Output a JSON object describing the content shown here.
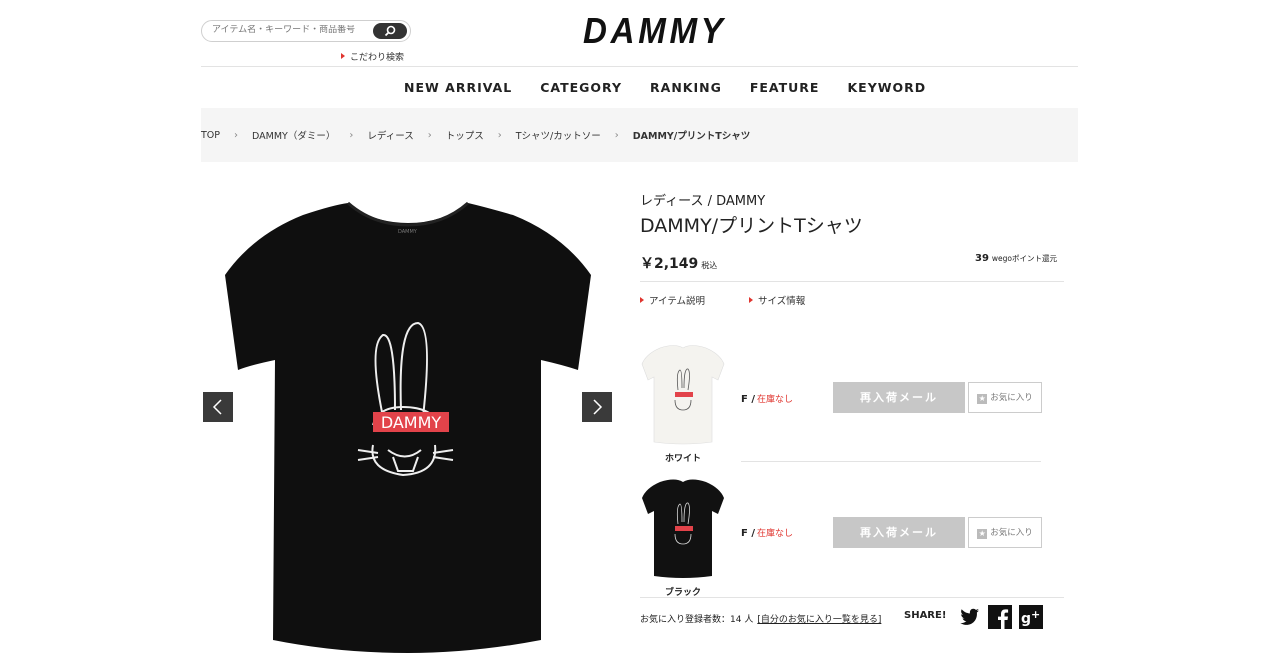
{
  "header": {
    "logo": "DAMMY",
    "search_placeholder": "アイテム名・キーワード・商品番号",
    "advanced_search": "こだわり検索"
  },
  "nav": [
    "NEW ARRIVAL",
    "CATEGORY",
    "RANKING",
    "FEATURE",
    "KEYWORD"
  ],
  "breadcrumb": [
    "TOP",
    "DAMMY（ダミー）",
    "レディース",
    "トップス",
    "Tシャツ/カットソー",
    "DAMMY/プリントTシャツ"
  ],
  "product": {
    "category": "レディース / DAMMY",
    "name": "DAMMY/プリントTシャツ",
    "price": "￥2,149",
    "tax_label": "税込",
    "points_value": "39",
    "points_label": "wegoポイント還元",
    "item_description_link": "アイテム説明",
    "size_info_link": "サイズ情報",
    "print_text": "DAMMY",
    "tag_text": "DAMMY"
  },
  "variants": [
    {
      "color": "ホワイト",
      "size": "F",
      "stock": "在庫なし",
      "restock_button": "再入荷メール",
      "fav_button": "お気に入り",
      "shirt_color": "#f4f3ef"
    },
    {
      "color": "ブラック",
      "size": "F",
      "stock": "在庫なし",
      "restock_button": "再入荷メール",
      "fav_button": "お気に入り",
      "shirt_color": "#111111"
    }
  ],
  "footer": {
    "fav_count_text": "お気に入り登録者数：14 人",
    "fav_list_link": "[自分のお気に入り一覧を見る]",
    "share_label": "SHARE!"
  },
  "colors": {
    "accent": "#e0352f",
    "shirt": "#0f0f0f",
    "button_disabled": "#c7c7c7"
  }
}
